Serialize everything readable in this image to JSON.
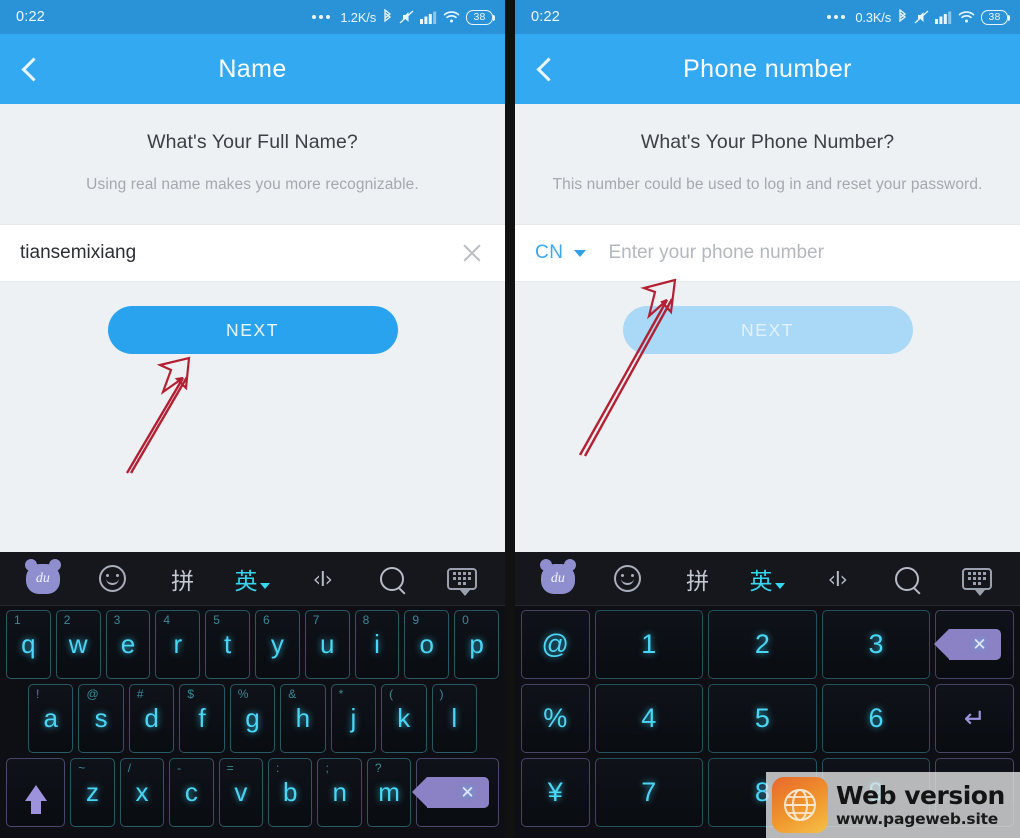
{
  "screens": [
    {
      "id": "name-screen",
      "statusbar": {
        "time": "0:22",
        "network_speed": "1.2K/s",
        "battery": "38",
        "icons": [
          "more-dots-icon",
          "bluetooth-icon",
          "mute-icon",
          "signal-bars-icon",
          "wifi-icon",
          "battery-icon"
        ]
      },
      "appbar": {
        "title": "Name",
        "back_icon": "chevron-left-icon"
      },
      "prompt": {
        "heading": "What's Your Full Name?",
        "subtext": "Using real name makes you more recognizable."
      },
      "input": {
        "value": "tiansemixiang",
        "placeholder": "",
        "clear_icon": "close-x-icon",
        "prefix": null
      },
      "next_button": {
        "label": "NEXT",
        "disabled": false,
        "color": "#2aa3ef"
      },
      "keyboard": {
        "type": "qwerty",
        "toolbar": [
          {
            "name": "baidu-logo-icon",
            "label": "du"
          },
          {
            "name": "emoji-icon",
            "label": ""
          },
          {
            "name": "pinyin-mode-icon",
            "label": "拼"
          },
          {
            "name": "english-mode-icon",
            "label": "英"
          },
          {
            "name": "cursor-move-icon",
            "label": "‹I›"
          },
          {
            "name": "search-icon",
            "label": ""
          },
          {
            "name": "hide-keyboard-icon",
            "label": ""
          }
        ],
        "rows": [
          [
            {
              "key": "q",
              "sup": "1"
            },
            {
              "key": "w",
              "sup": "2"
            },
            {
              "key": "e",
              "sup": "3"
            },
            {
              "key": "r",
              "sup": "4"
            },
            {
              "key": "t",
              "sup": "5"
            },
            {
              "key": "y",
              "sup": "6"
            },
            {
              "key": "u",
              "sup": "7"
            },
            {
              "key": "i",
              "sup": "8"
            },
            {
              "key": "o",
              "sup": "9"
            },
            {
              "key": "p",
              "sup": "0"
            }
          ],
          [
            {
              "key": "a",
              "sup": "!"
            },
            {
              "key": "s",
              "sup": "@"
            },
            {
              "key": "d",
              "sup": "#"
            },
            {
              "key": "f",
              "sup": "$"
            },
            {
              "key": "g",
              "sup": "%"
            },
            {
              "key": "h",
              "sup": "&"
            },
            {
              "key": "j",
              "sup": "*"
            },
            {
              "key": "k",
              "sup": "("
            },
            {
              "key": "l",
              "sup": ")"
            }
          ],
          [
            {
              "key": "shift",
              "sup": "",
              "kind": "shift"
            },
            {
              "key": "z",
              "sup": "~"
            },
            {
              "key": "x",
              "sup": "/"
            },
            {
              "key": "c",
              "sup": "-"
            },
            {
              "key": "v",
              "sup": "="
            },
            {
              "key": "b",
              "sup": ":"
            },
            {
              "key": "n",
              "sup": ";"
            },
            {
              "key": "m",
              "sup": "?"
            },
            {
              "key": "delete",
              "sup": "",
              "kind": "delete"
            }
          ]
        ]
      }
    },
    {
      "id": "phone-screen",
      "statusbar": {
        "time": "0:22",
        "network_speed": "0.3K/s",
        "battery": "38",
        "icons": [
          "more-dots-icon",
          "bluetooth-icon",
          "mute-icon",
          "signal-bars-icon",
          "wifi-icon",
          "battery-icon"
        ]
      },
      "appbar": {
        "title": "Phone number",
        "back_icon": "chevron-left-icon"
      },
      "prompt": {
        "heading": "What's Your Phone Number?",
        "subtext": "This number could be used to log in and reset your password."
      },
      "input": {
        "value": "",
        "placeholder": "Enter your phone number",
        "clear_icon": null,
        "prefix": "CN"
      },
      "next_button": {
        "label": "NEXT",
        "disabled": true,
        "color": "#a9d9f6"
      },
      "keyboard": {
        "type": "numeric",
        "toolbar": [
          {
            "name": "baidu-logo-icon",
            "label": "du"
          },
          {
            "name": "emoji-icon",
            "label": ""
          },
          {
            "name": "pinyin-mode-icon",
            "label": "拼"
          },
          {
            "name": "english-mode-icon",
            "label": "英"
          },
          {
            "name": "cursor-move-icon",
            "label": "‹I›"
          },
          {
            "name": "search-icon",
            "label": ""
          },
          {
            "name": "hide-keyboard-icon",
            "label": ""
          }
        ],
        "rows": [
          [
            {
              "key": "@",
              "kind": "sym"
            },
            {
              "key": "1"
            },
            {
              "key": "2"
            },
            {
              "key": "3"
            },
            {
              "key": "delete",
              "kind": "delete"
            }
          ],
          [
            {
              "key": "%",
              "kind": "sym"
            },
            {
              "key": "4"
            },
            {
              "key": "5"
            },
            {
              "key": "6"
            },
            {
              "key": "enter",
              "kind": "enter"
            }
          ],
          [
            {
              "key": "¥",
              "kind": "sym"
            },
            {
              "key": "7"
            },
            {
              "key": "8"
            },
            {
              "key": "9"
            },
            {
              "key": "",
              "kind": "blank"
            }
          ]
        ]
      }
    }
  ],
  "annotations": {
    "arrow_color": "#b42033",
    "arrows": [
      {
        "name": "arrow-pointing-to-next-button",
        "target": "next-button"
      },
      {
        "name": "arrow-pointing-to-phone-input",
        "target": "phone-number-input"
      }
    ]
  },
  "watermark": {
    "title": "Web version",
    "url": "www.pageweb.site",
    "icon": "globe-icon"
  }
}
